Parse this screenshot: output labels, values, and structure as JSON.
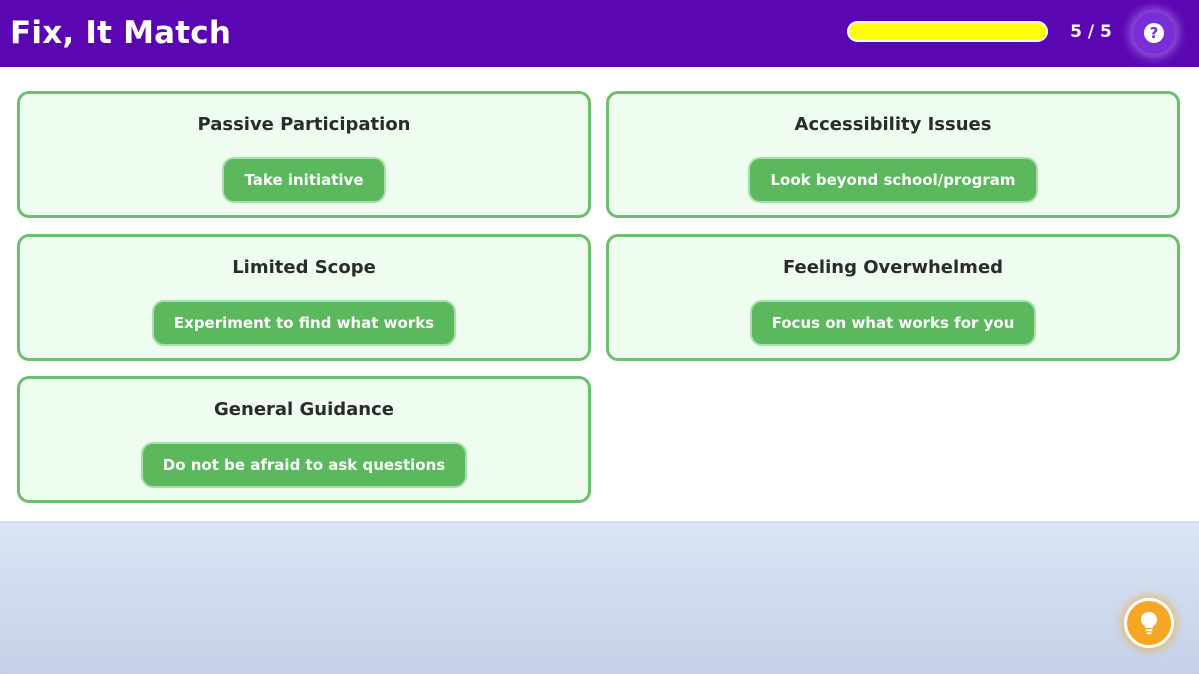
{
  "header": {
    "title": "Fix, It Match",
    "progress_fraction": 1.0,
    "counter": "5 / 5",
    "help_icon_glyph": "?",
    "help_icon": "question-circle-icon"
  },
  "cards": [
    {
      "title": "Passive Participation",
      "chip": "Take initiative"
    },
    {
      "title": "Accessibility Issues",
      "chip": "Look beyond school/program"
    },
    {
      "title": "Limited Scope",
      "chip": "Experiment to find what works"
    },
    {
      "title": "Feeling Overwhelmed",
      "chip": "Focus on what works for you"
    },
    {
      "title": "General Guidance",
      "chip": "Do not be afraid to ask questions"
    }
  ],
  "hint": {
    "icon": "lightbulb-icon"
  },
  "colors": {
    "header_bg": "#5a06b3",
    "progress_fill": "#ffff00",
    "card_border": "#6cbf6c",
    "card_bg": "#effcf0",
    "chip_bg": "#5bb85d",
    "hint_bg": "#f5a623"
  }
}
